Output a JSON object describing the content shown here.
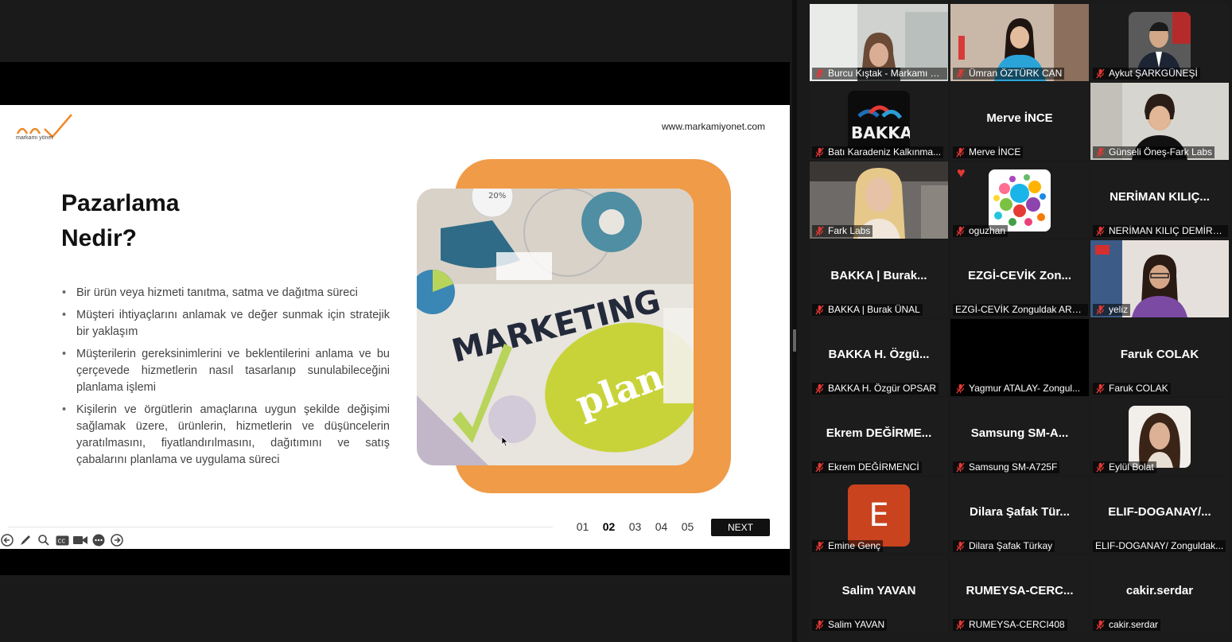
{
  "slide": {
    "url": "www.markamiyonet.com",
    "logo_text": "markamı yönet",
    "title_line1": "Pazarlama",
    "title_line2": "Nedir?",
    "bullets": [
      "Bir ürün veya hizmeti tanıtma, satma ve dağıtma süreci",
      "Müşteri ihtiyaçlarını anlamak ve değer sunmak için stratejik bir yaklaşım",
      "Müşterilerin gereksinimlerini ve beklentilerini anlama ve bu çerçevede hizmetlerin nasıl tasarlanıp sunulabileceğini planlama işlemi",
      "Kişilerin ve örgütlerin amaçlarına uygun şekilde değişimi sağlamak üzere, ürünlerin, hizmetlerin ve düşüncelerin yaratılmasını, fiyatlandırılmasını, dağıtımını ve satış çabalarını planlama ve uygulama süreci"
    ],
    "photo_words": [
      "MARKETING",
      "plan",
      "20%"
    ],
    "pages": [
      "01",
      "02",
      "03",
      "04",
      "05"
    ],
    "active_page": "02",
    "next_label": "NEXT"
  },
  "toolbar": {
    "icons": [
      "back-arrow-icon",
      "pen-icon",
      "zoom-icon",
      "captions-icon",
      "video-icon",
      "more-icon",
      "forward-arrow-icon"
    ],
    "cc_label": "CC"
  },
  "participants": [
    {
      "label": "Burcu Kıştak - Markamı Yön...",
      "speaking": true,
      "video": "woman-office"
    },
    {
      "label": "Ümran ÖZTÜRK CAN",
      "video": "woman-flags"
    },
    {
      "label": "Aykut ŞARKGÜNEŞİ",
      "video": "man-suit"
    },
    {
      "label": "Batı Karadeniz Kalkınma...",
      "video": "bakka-logo",
      "logo_text": "BAKKA"
    },
    {
      "label": "Merve İNCE",
      "bigname": "Merve İNCE"
    },
    {
      "label": "Günseli Öneş-Fark Labs",
      "video": "woman-office2"
    },
    {
      "label": "Fark Labs",
      "video": "woman-blonde"
    },
    {
      "label": "oguzhan",
      "video": "dots-avatar"
    },
    {
      "label": "NERİMAN KILIÇ DEMİRC...",
      "bigname": "NERİMAN KILIÇ..."
    },
    {
      "label": "BAKKA | Burak ÜNAL",
      "bigname": "BAKKA | Burak..."
    },
    {
      "label": "EZGİ-CEVİK Zonguldak ARGE",
      "bigname": "EZGİ-CEVİK Zon...",
      "nomic": true
    },
    {
      "label": "yeliz",
      "video": "woman-glasses"
    },
    {
      "label": "BAKKA H. Özgür OPSAR",
      "bigname": "BAKKA H. Özgü..."
    },
    {
      "label": "Yagmur ATALAY- Zongul...",
      "video": "black"
    },
    {
      "label": "Faruk COLAK",
      "bigname": "Faruk COLAK"
    },
    {
      "label": "Ekrem DEĞİRMENCİ",
      "bigname": "Ekrem DEĞİRME..."
    },
    {
      "label": "Samsung SM-A725F",
      "bigname": "Samsung SM-A..."
    },
    {
      "label": "Eylül Bolat",
      "video": "woman-curly"
    },
    {
      "label": "Emine Genç",
      "video": "letter-avatar",
      "letter": "E"
    },
    {
      "label": "Dilara Şafak Türkay",
      "bigname": "Dilara Şafak Tür..."
    },
    {
      "label": "ELIF-DOGANAY/ Zonguldak...",
      "bigname": "ELIF-DOGANAY/...",
      "nomic": true
    },
    {
      "label": "Salim YAVAN",
      "bigname": "Salim YAVAN"
    },
    {
      "label": "RUMEYSA-CERCI408",
      "bigname": "RUMEYSA-CERC..."
    },
    {
      "label": "cakir.serdar",
      "bigname": "cakir.serdar"
    }
  ],
  "colors": {
    "accent_orange": "#ef9b48",
    "speaking_border": "#2ecc71",
    "muted_mic": "#e53935"
  }
}
